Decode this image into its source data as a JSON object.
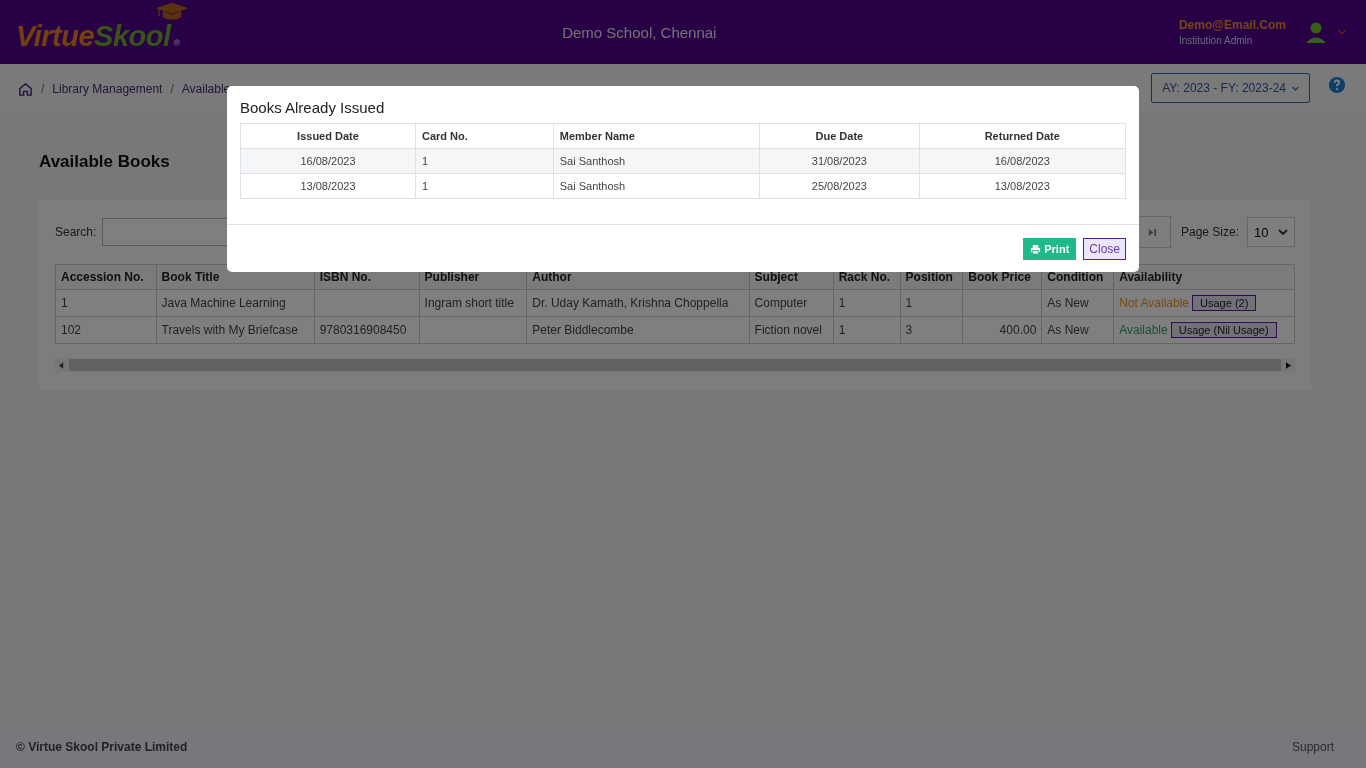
{
  "header": {
    "logo": {
      "first": "Virtue",
      "second": "Skool",
      "mark": "®"
    },
    "school": "Demo School, Chennai",
    "user": {
      "email": "Demo@Email.Com",
      "role": "Institution Admin"
    }
  },
  "breadcrumb": [
    {
      "separator": "/",
      "label": "Library Management"
    },
    {
      "separator": "/",
      "label": "Available"
    }
  ],
  "year_selector": "AY: 2023 - FY: 2023-24",
  "page_title": "Available Books",
  "search": {
    "label": "Search:"
  },
  "page_size": {
    "label": "Page Size:",
    "value": "10"
  },
  "books": {
    "columns": [
      "Accession No.",
      "Book Title",
      "ISBN No.",
      "Publisher",
      "Author",
      "Subject",
      "Rack No.",
      "Position",
      "Book Price",
      "Condition",
      "Availability"
    ],
    "rows": [
      {
        "cells": [
          "1",
          "Java Machine Learning",
          "",
          "Ingram short title",
          "Dr. Uday Kamath, Krishna Choppella",
          "Computer",
          "1",
          "1",
          "",
          "As New"
        ],
        "available": false,
        "status": "Not Available",
        "usage": "Usage (2)"
      },
      {
        "cells": [
          "102",
          "Travels with My Briefcase",
          "9780316908450",
          "",
          "Peter Biddlecombe",
          "Fiction novel",
          "1",
          "3",
          "400.00",
          "As New"
        ],
        "available": true,
        "status": "Available",
        "usage": "Usage (Nil Usage)"
      }
    ]
  },
  "modal": {
    "title": "Books Already Issued",
    "columns": [
      "Issued Date",
      "Card No.",
      "Member Name",
      "Due Date",
      "Returned Date"
    ],
    "rows": [
      [
        "16/08/2023",
        "1",
        "Sai Santhosh",
        "31/08/2023",
        "16/08/2023"
      ],
      [
        "13/08/2023",
        "1",
        "Sai Santhosh",
        "25/08/2023",
        "13/08/2023"
      ]
    ],
    "buttons": {
      "print": "Print",
      "close": "Close"
    }
  },
  "footer": {
    "copyright": "© Virtue Skool Private Limited",
    "support": "Support"
  }
}
